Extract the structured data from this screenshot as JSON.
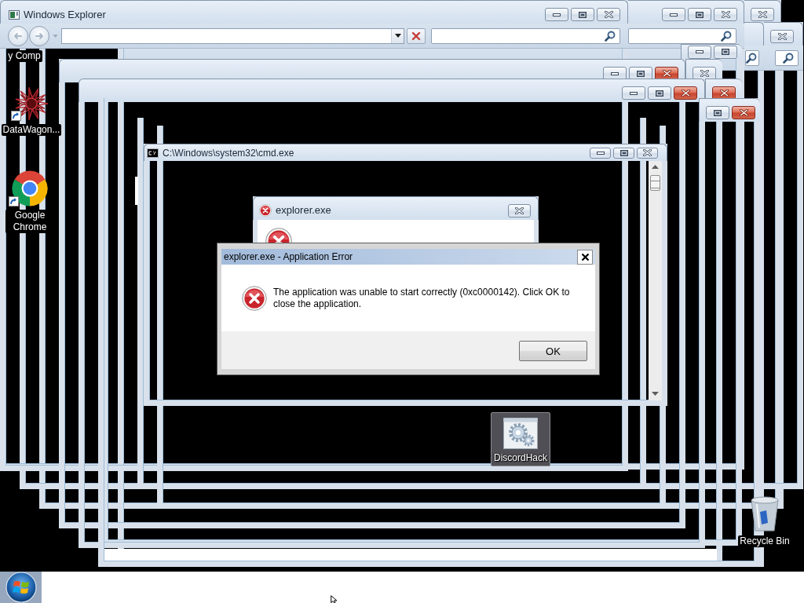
{
  "explorer_window": {
    "title": "Windows Explorer"
  },
  "background_windows": [
    {
      "kind": "frame"
    },
    {
      "kind": "explorer",
      "close_active": false
    },
    {
      "kind": "explorer",
      "close_active": false
    },
    {
      "kind": "explorer"
    },
    {
      "kind": "explorer",
      "close_active": false
    },
    {
      "kind": "controls"
    },
    {
      "kind": "controls",
      "close_active": false
    },
    {
      "kind": "titled",
      "close_active": true
    },
    {
      "kind": "controls",
      "close_active": true
    },
    {
      "kind": "titled",
      "close_active": true
    },
    {
      "kind": "controls",
      "close_active": true
    },
    {
      "kind": "frame"
    },
    {
      "kind": "frame"
    }
  ],
  "desktop_icons": [
    {
      "kind": "computer",
      "label": "y Comp",
      "selected": false
    },
    {
      "kind": "starburst_app",
      "label": "DataWagon...",
      "shortcut": true,
      "selected": false
    },
    {
      "kind": "browser",
      "label": "Google Chrome",
      "shortcut": true,
      "selected": false
    },
    {
      "kind": "gear_app",
      "label": "DiscordHack",
      "shortcut": false,
      "selected": true
    },
    {
      "kind": "recycle_bin",
      "label": "Recycle Bin",
      "shortcut": false,
      "selected": false
    }
  ],
  "console_window": {
    "title": "C:\\Windows\\system32\\cmd.exe"
  },
  "error_window": {
    "title": "explorer.exe"
  },
  "error_dialog": {
    "title": "explorer.exe - Application Error",
    "message": "The application was unable to start correctly (0xc0000142). Click OK to close the application.",
    "button": "OK"
  }
}
